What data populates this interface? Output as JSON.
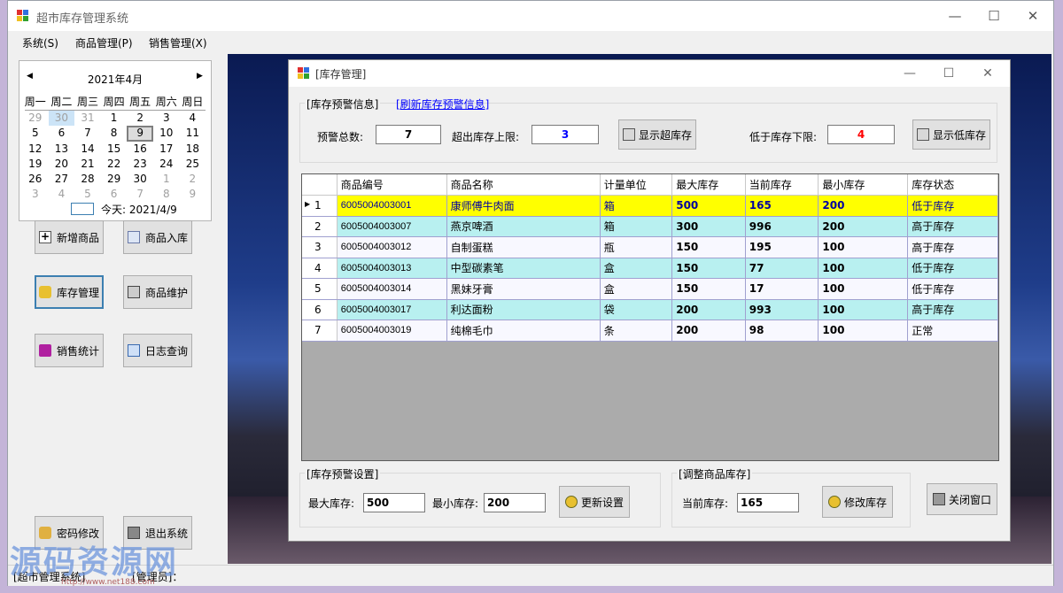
{
  "window": {
    "title": "超市库存管理系统"
  },
  "menu": [
    {
      "label": "系统(S)"
    },
    {
      "label": "商品管理(P)"
    },
    {
      "label": "销售管理(X)"
    }
  ],
  "calendar": {
    "month_label": "2021年4月",
    "weekdays": [
      "周一",
      "周二",
      "周三",
      "周四",
      "周五",
      "周六",
      "周日"
    ],
    "days": [
      "29",
      "30",
      "31",
      "1",
      "2",
      "3",
      "4",
      "5",
      "6",
      "7",
      "8",
      "9",
      "10",
      "11",
      "12",
      "13",
      "14",
      "15",
      "16",
      "17",
      "18",
      "19",
      "20",
      "21",
      "22",
      "23",
      "24",
      "25",
      "26",
      "27",
      "28",
      "29",
      "30",
      "1",
      "2",
      "3",
      "4",
      "5",
      "6",
      "7",
      "8",
      "9"
    ],
    "today_label": "今天: 2021/4/9"
  },
  "left_buttons": [
    {
      "label": "新增商品",
      "icon": "plus-icon"
    },
    {
      "label": "商品入库",
      "icon": "import-icon"
    },
    {
      "label": "库存管理",
      "icon": "key-icon"
    },
    {
      "label": "商品维护",
      "icon": "maintain-icon"
    },
    {
      "label": "销售统计",
      "icon": "stats-icon"
    },
    {
      "label": "日志查询",
      "icon": "log-icon"
    },
    {
      "label": "密码修改",
      "icon": "key-icon"
    },
    {
      "label": "退出系统",
      "icon": "exit-icon"
    }
  ],
  "status_bar": {
    "system": "[超市管理系统]",
    "role": "[管理员]："
  },
  "watermark": {
    "text": "源码资源网",
    "url": "http://www.net188.com"
  },
  "inventory": {
    "title": "[库存管理]",
    "alert_group": {
      "title": "[库存预警信息]",
      "refresh_link": "[刷新库存预警信息]",
      "total_label": "预警总数:",
      "total_value": "7",
      "over_label": "超出库存上限:",
      "over_value": "3",
      "show_over_button": "显示超库存",
      "under_label": "低于库存下限:",
      "under_value": "4",
      "show_under_button": "显示低库存"
    },
    "table": {
      "columns": [
        "商品编号",
        "商品名称",
        "计量单位",
        "最大库存",
        "当前库存",
        "最小库存",
        "库存状态"
      ],
      "rows": [
        {
          "no": "1",
          "code": "6005004003001",
          "name": "康师傅牛肉面",
          "unit": "箱",
          "max": "500",
          "cur": "165",
          "min": "200",
          "status": "低于库存"
        },
        {
          "no": "2",
          "code": "6005004003007",
          "name": "燕京啤酒",
          "unit": "箱",
          "max": "300",
          "cur": "996",
          "min": "200",
          "status": "高于库存"
        },
        {
          "no": "3",
          "code": "6005004003012",
          "name": "自制蛋糕",
          "unit": "瓶",
          "max": "150",
          "cur": "195",
          "min": "100",
          "status": "高于库存"
        },
        {
          "no": "4",
          "code": "6005004003013",
          "name": "中型碳素笔",
          "unit": "盒",
          "max": "150",
          "cur": "77",
          "min": "100",
          "status": "低于库存"
        },
        {
          "no": "5",
          "code": "6005004003014",
          "name": "黑妹牙膏",
          "unit": "盒",
          "max": "150",
          "cur": "17",
          "min": "100",
          "status": "低于库存"
        },
        {
          "no": "6",
          "code": "6005004003017",
          "name": "利达面粉",
          "unit": "袋",
          "max": "200",
          "cur": "993",
          "min": "100",
          "status": "高于库存"
        },
        {
          "no": "7",
          "code": "6005004003019",
          "name": "纯棉毛巾",
          "unit": "条",
          "max": "200",
          "cur": "98",
          "min": "100",
          "status": "正常"
        }
      ]
    },
    "settings_group": {
      "title": "[库存预警设置]",
      "max_label": "最大库存:",
      "max_value": "500",
      "min_label": "最小库存:",
      "min_value": "200",
      "update_button": "更新设置"
    },
    "adjust_group": {
      "title": "[调整商品库存]",
      "current_label": "当前库存:",
      "current_value": "165",
      "modify_button": "修改库存"
    },
    "close_button": "关闭窗口"
  },
  "colors": {
    "selected_row": "#ffff00",
    "alt_row": "#b8f0f0",
    "over_value": "#0000ff",
    "under_value": "#ff0000",
    "link": "#0000ff"
  }
}
